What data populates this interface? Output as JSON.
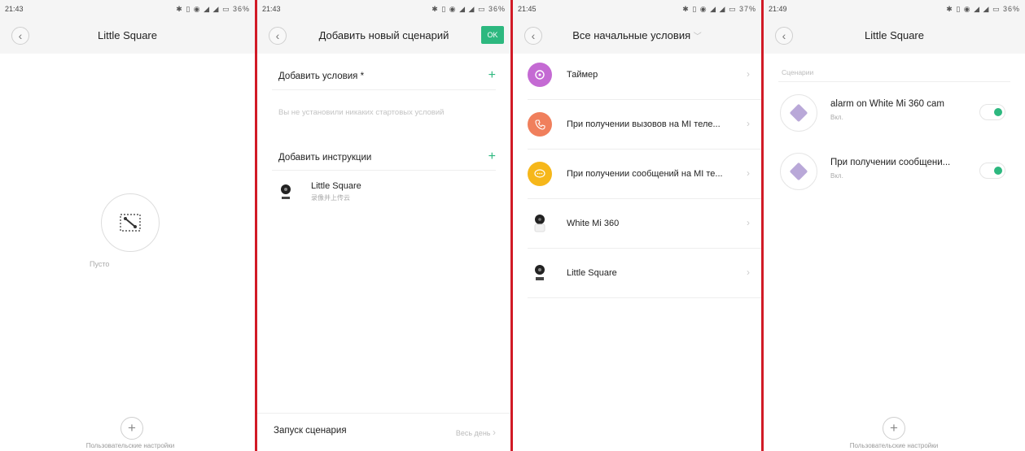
{
  "screens": [
    {
      "time": "21:43",
      "status_icons": "✱ ▯ ◉ ◢ ◢ ▭ 36%",
      "title": "Little Square",
      "empty_label": "Пусто",
      "footer_label": "Пользовательские настройки"
    },
    {
      "time": "21:43",
      "status_icons": "✱ ▯ ◉ ◢ ◢ ▭ 36%",
      "title": "Добавить новый сценарий",
      "ok_label": "OK",
      "add_conditions": "Добавить условия *",
      "no_conditions": "Вы не установили никаких стартовых условий",
      "add_instructions": "Добавить инструкции",
      "device": {
        "name": "Little Square",
        "sub": "录像并上传云"
      },
      "launch_label": "Запуск сценария",
      "launch_value": "Весь день"
    },
    {
      "time": "21:45",
      "status_icons": "✱ ▯ ◉ ◢ ◢ ▭ 37%",
      "title": "Все начальные условия",
      "items": [
        {
          "label": "Таймер",
          "color": "#c46ad3"
        },
        {
          "label": "При получении вызовов на MI теле...",
          "color": "#f07f5c"
        },
        {
          "label": "При получении сообщений на MI те...",
          "color": "#f6b71a"
        },
        {
          "label": "White Mi 360",
          "color": ""
        },
        {
          "label": "Little Square",
          "color": ""
        }
      ]
    },
    {
      "time": "21:49",
      "status_icons": "✱ ▯ ◉ ◢ ◢ ▭ 36%",
      "title": "Little Square",
      "section": "Сценарии",
      "scenes": [
        {
          "name": "alarm on White Mi 360 cam",
          "sub": "Вкл."
        },
        {
          "name": "При получении сообщени...",
          "sub": "Вкл."
        }
      ],
      "footer_label": "Пользовательские настройки"
    }
  ],
  "icons": {
    "back": "‹",
    "chevron": "›",
    "plus": "+",
    "dropdown": "﹀"
  }
}
